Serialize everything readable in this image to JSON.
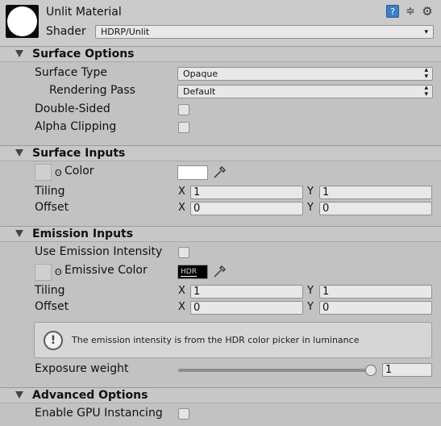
{
  "header": {
    "title": "Unlit Material",
    "shader_label": "Shader",
    "shader_value": "HDRP/Unlit"
  },
  "sections": {
    "surface_options": {
      "title": "Surface Options",
      "surface_type_label": "Surface Type",
      "surface_type_value": "Opaque",
      "rendering_pass_label": "Rendering Pass",
      "rendering_pass_value": "Default",
      "double_sided_label": "Double-Sided",
      "double_sided": false,
      "alpha_clipping_label": "Alpha Clipping",
      "alpha_clipping": false
    },
    "surface_inputs": {
      "title": "Surface Inputs",
      "color_label": "Color",
      "color_value": "#ffffff",
      "tiling_label": "Tiling",
      "tiling_x": "1",
      "tiling_y": "1",
      "offset_label": "Offset",
      "offset_x": "0",
      "offset_y": "0",
      "axis_x": "X",
      "axis_y": "Y"
    },
    "emission_inputs": {
      "title": "Emission Inputs",
      "use_intensity_label": "Use Emission Intensity",
      "use_intensity": false,
      "emissive_color_label": "Emissive Color",
      "emissive_color_value": "#000000",
      "hdr_badge": "HDR",
      "tiling_label": "Tiling",
      "tiling_x": "1",
      "tiling_y": "1",
      "offset_label": "Offset",
      "offset_x": "0",
      "offset_y": "0",
      "axis_x": "X",
      "axis_y": "Y",
      "help_text": "The emission intensity is from the HDR color picker in luminance",
      "exposure_label": "Exposure weight",
      "exposure_value": "1",
      "exposure_fraction": 1.0
    },
    "advanced_options": {
      "title": "Advanced Options",
      "gpu_instancing_label": "Enable GPU Instancing",
      "gpu_instancing": false
    }
  },
  "icons": {
    "help": "book-help-icon",
    "presets": "presets-icon",
    "settings": "gear-icon"
  }
}
